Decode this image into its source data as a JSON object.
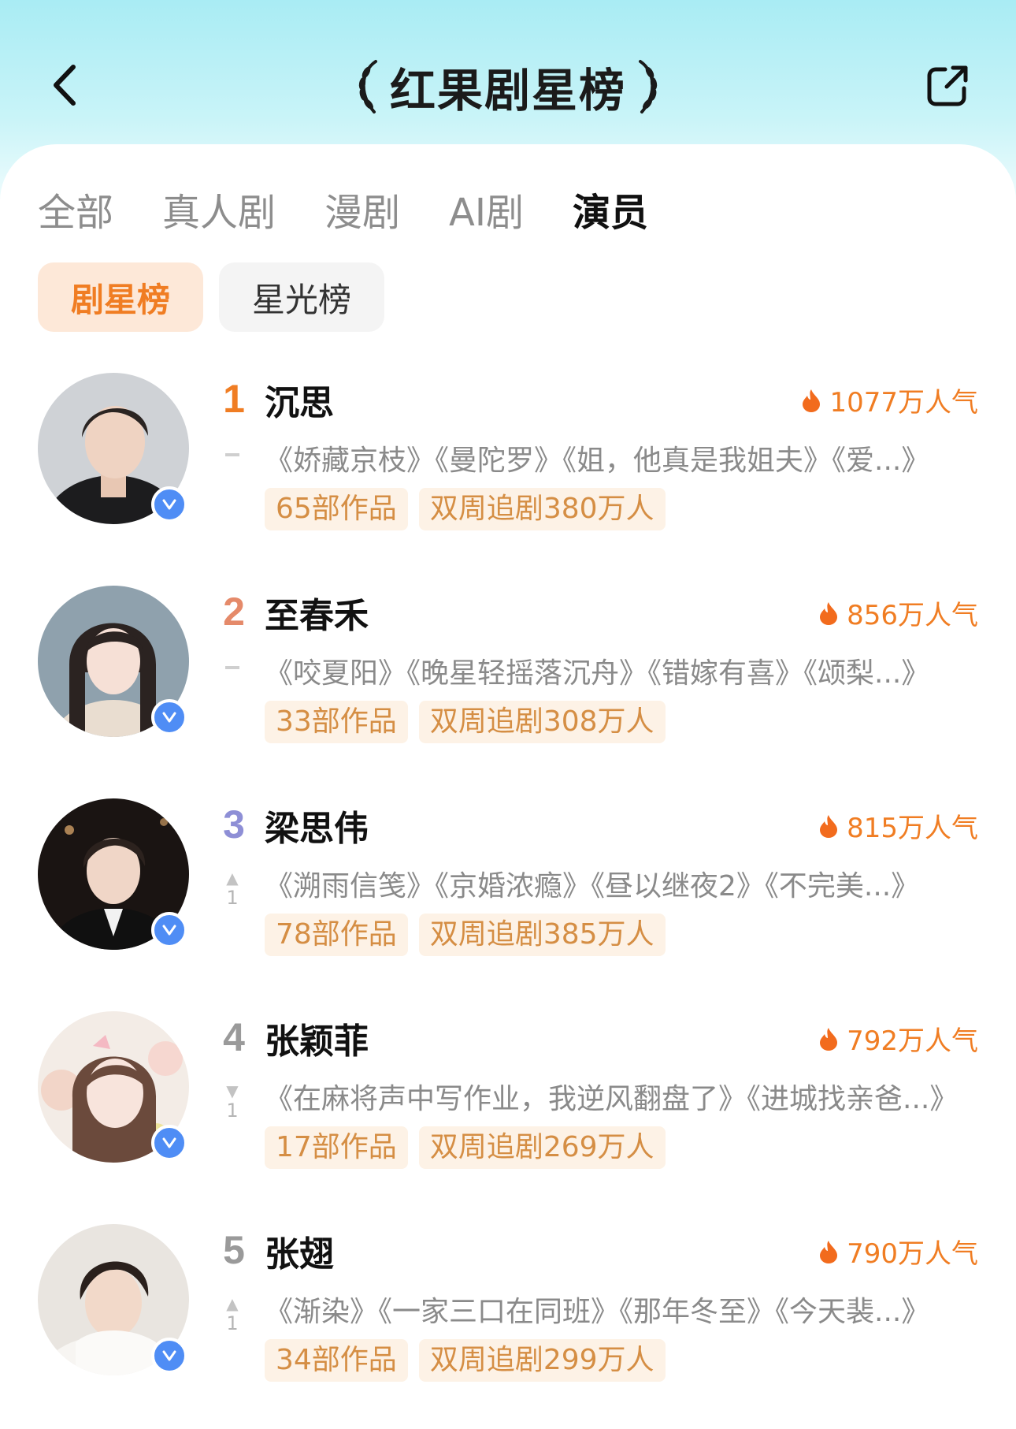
{
  "header": {
    "title": "红果剧星榜",
    "back_icon": "chevron-left-icon",
    "share_icon": "share-icon"
  },
  "tabs": [
    {
      "label": "全部",
      "active": false
    },
    {
      "label": "真人剧",
      "active": false
    },
    {
      "label": "漫剧",
      "active": false
    },
    {
      "label": "AI剧",
      "active": false
    },
    {
      "label": "演员",
      "active": true
    }
  ],
  "subtabs": [
    {
      "label": "剧星榜",
      "active": true
    },
    {
      "label": "星光榜",
      "active": false
    }
  ],
  "colors": {
    "accent": "#f07d23",
    "tag_text": "#d58e44",
    "tag_bg": "#fdf2e6",
    "verified": "#4f8df5",
    "rank1": "#f07d23",
    "rank2": "#e58a6a",
    "rank3": "#8e8fd6",
    "rank_other": "#9a9a9a"
  },
  "actors": [
    {
      "rank": "1",
      "name": "沉思",
      "popularity": "1077万人气",
      "trend": "flat",
      "trend_value": "",
      "works": "《娇藏京枝》《曼陀罗》《姐，他真是我姐夫》《爱...》",
      "works_count": "65部作品",
      "followers": "双周追剧380万人"
    },
    {
      "rank": "2",
      "name": "至春禾",
      "popularity": "856万人气",
      "trend": "flat",
      "trend_value": "",
      "works": "《咬夏阳》《晚星轻摇落沉舟》《错嫁有喜》《颂梨...》",
      "works_count": "33部作品",
      "followers": "双周追剧308万人"
    },
    {
      "rank": "3",
      "name": "梁思伟",
      "popularity": "815万人气",
      "trend": "up",
      "trend_value": "1",
      "works": "《溯雨信笺》《京婚浓瘾》《昼以继夜2》《不完美...》",
      "works_count": "78部作品",
      "followers": "双周追剧385万人"
    },
    {
      "rank": "4",
      "name": "张颖菲",
      "popularity": "792万人气",
      "trend": "down",
      "trend_value": "1",
      "works": "《在麻将声中写作业，我逆风翻盘了》《进城找亲爸...》",
      "works_count": "17部作品",
      "followers": "双周追剧269万人"
    },
    {
      "rank": "5",
      "name": "张翅",
      "popularity": "790万人气",
      "trend": "up",
      "trend_value": "1",
      "works": "《渐染》《一家三口在同班》《那年冬至》《今天裴...》",
      "works_count": "34部作品",
      "followers": "双周追剧299万人"
    }
  ]
}
